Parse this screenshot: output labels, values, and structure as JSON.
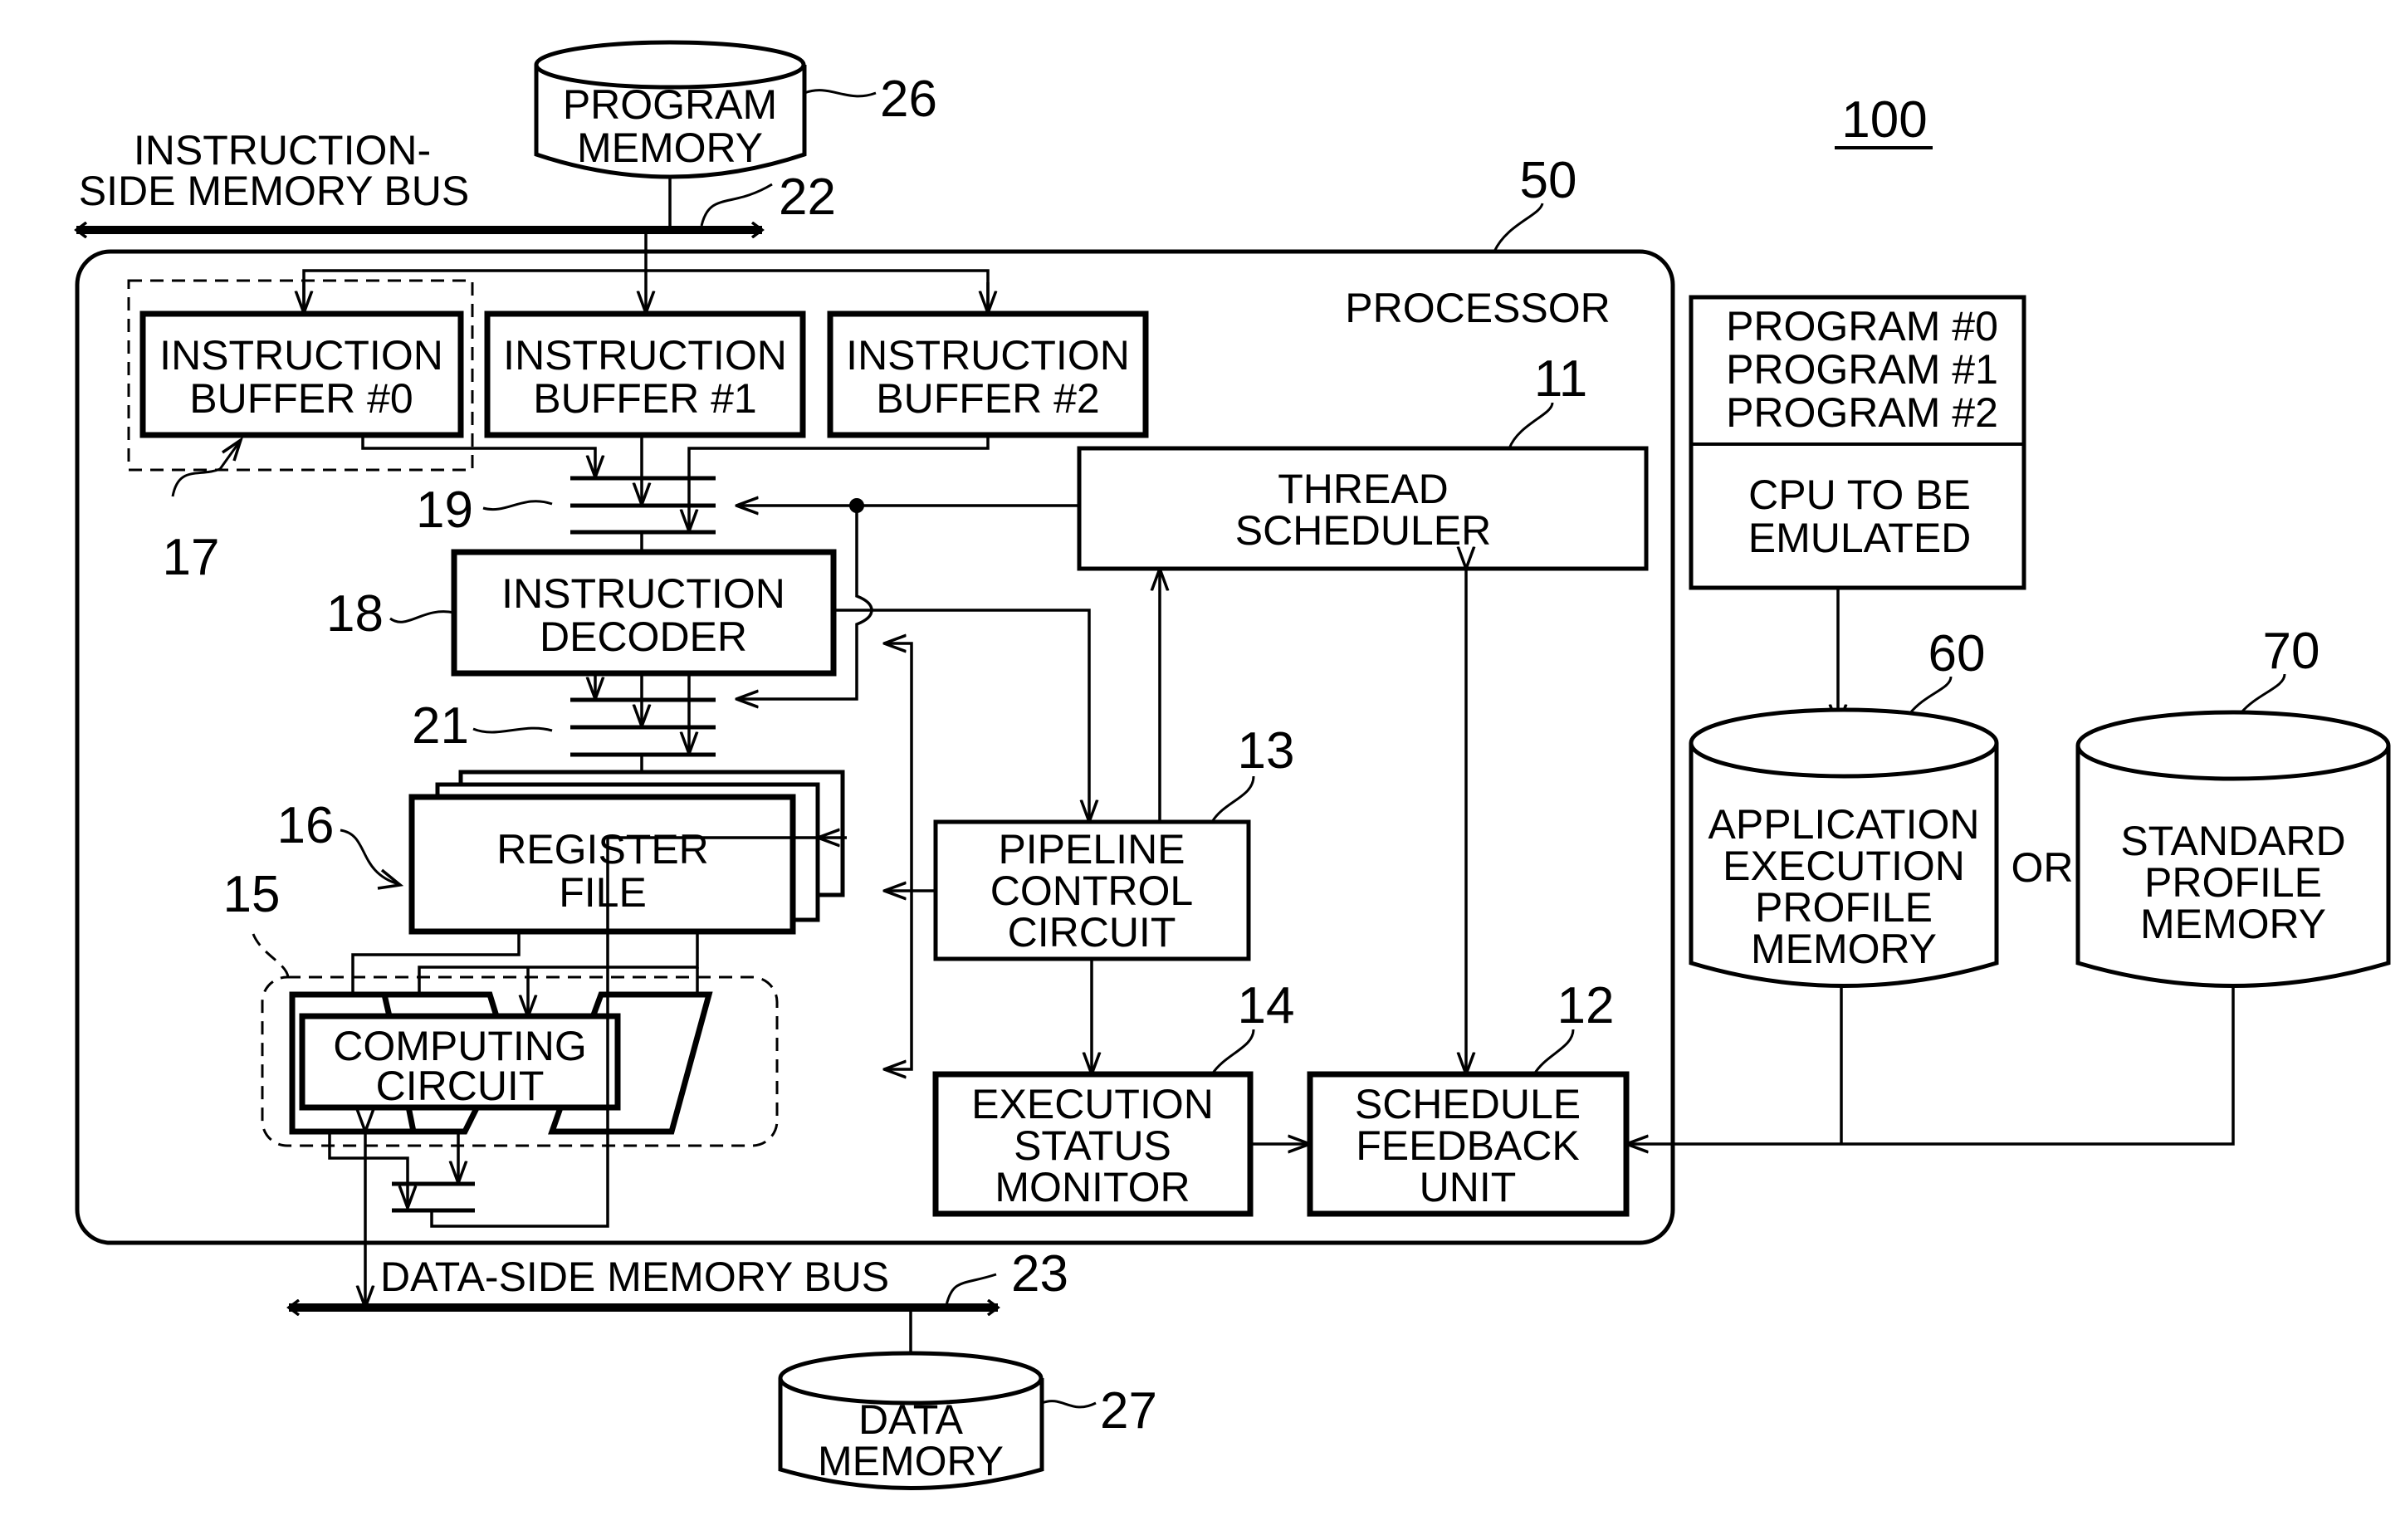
{
  "figure_ref": "100",
  "processor": {
    "label": "PROCESSOR",
    "ref": "50"
  },
  "program_memory": {
    "lines": [
      "PROGRAM",
      "MEMORY"
    ],
    "ref": "26"
  },
  "instruction_bus": {
    "lines": [
      "INSTRUCTION-",
      "SIDE MEMORY BUS"
    ],
    "ref": "22"
  },
  "data_bus": {
    "label": "DATA-SIDE MEMORY BUS",
    "ref": "23"
  },
  "data_memory": {
    "lines": [
      "DATA",
      "MEMORY"
    ],
    "ref": "27"
  },
  "instruction_buffers": [
    {
      "lines": [
        "INSTRUCTION",
        "BUFFER #0"
      ]
    },
    {
      "lines": [
        "INSTRUCTION",
        "BUFFER #1"
      ]
    },
    {
      "lines": [
        "INSTRUCTION",
        "BUFFER #2"
      ]
    }
  ],
  "buffer_group_ref": "17",
  "selector_19_ref": "19",
  "selector_21_ref": "21",
  "instruction_decoder": {
    "lines": [
      "INSTRUCTION",
      "DECODER"
    ],
    "ref": "18"
  },
  "register_file": {
    "lines": [
      "REGISTER",
      "FILE"
    ],
    "ref": "16"
  },
  "computing_group_ref": "15",
  "computing_circuit": {
    "lines": [
      "COMPUTING",
      "CIRCUIT"
    ]
  },
  "thread_scheduler": {
    "lines": [
      "THREAD",
      "SCHEDULER"
    ],
    "ref": "11"
  },
  "pipeline_control": {
    "lines": [
      "PIPELINE",
      "CONTROL",
      "CIRCUIT"
    ],
    "ref": "13"
  },
  "execution_status_monitor": {
    "lines": [
      "EXECUTION",
      "STATUS",
      "MONITOR"
    ],
    "ref": "14"
  },
  "schedule_feedback_unit": {
    "lines": [
      "SCHEDULE",
      "FEEDBACK",
      "UNIT"
    ],
    "ref": "12"
  },
  "program_table": {
    "programs": [
      "PROGRAM #0",
      "PROGRAM #1",
      "PROGRAM #2"
    ],
    "cpu_lines": [
      "CPU TO BE",
      "EMULATED"
    ]
  },
  "app_profile_memory": {
    "lines": [
      "APPLICATION",
      "EXECUTION",
      "PROFILE",
      "MEMORY"
    ],
    "ref": "60"
  },
  "or_label": "OR",
  "standard_profile_memory": {
    "lines": [
      "STANDARD",
      "PROFILE",
      "MEMORY"
    ],
    "ref": "70"
  }
}
